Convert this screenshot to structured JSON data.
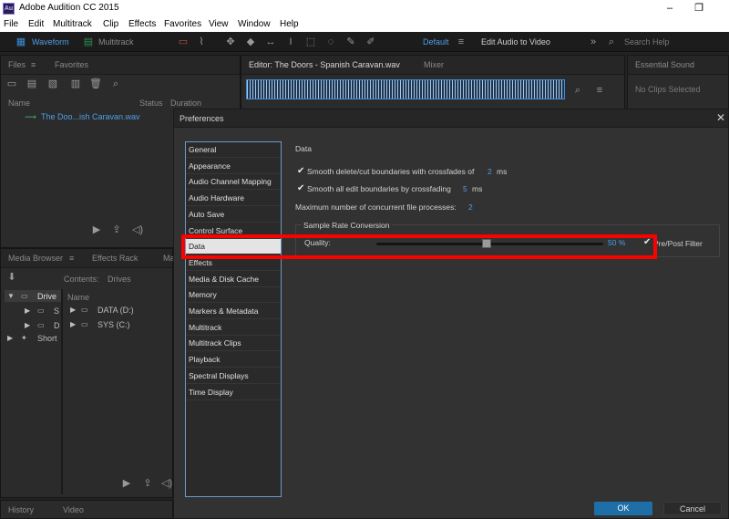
{
  "window": {
    "title": "Adobe Audition CC 2015",
    "icon_text": "Au"
  },
  "menu": [
    "File",
    "Edit",
    "Multitrack",
    "Clip",
    "Effects",
    "Favorites",
    "View",
    "Window",
    "Help"
  ],
  "toolbar": {
    "waveform": "Waveform",
    "multitrack": "Multitrack",
    "workspace": "Default",
    "workspace_alt": "Edit Audio to Video",
    "search_placeholder": "Search Help"
  },
  "files_panel": {
    "tabs": [
      "Files",
      "Favorites"
    ],
    "columns": [
      "Name",
      "Status",
      "Duration"
    ],
    "items": [
      "The Doo...ish Caravan.wav"
    ]
  },
  "editor_panel": {
    "tabs": [
      "Editor: The Doors - Spanish Caravan.wav",
      "Mixer"
    ]
  },
  "essential_sound": {
    "tab": "Essential Sound",
    "empty": "No Clips Selected"
  },
  "media_browser": {
    "tabs": [
      "Media Browser",
      "Effects Rack",
      "Ma"
    ],
    "contents_label": "Contents:",
    "contents_value": "Drives",
    "name_col": "Name",
    "tree": [
      "Drive",
      "S",
      "D",
      "Short"
    ],
    "drives": [
      "DATA (D:)",
      "SYS (C:)"
    ]
  },
  "bottom_tabs": [
    "History",
    "Video"
  ],
  "preferences": {
    "title": "Preferences",
    "categories": [
      "General",
      "Appearance",
      "Audio Channel Mapping",
      "Audio Hardware",
      "Auto Save",
      "Control Surface",
      "Data",
      "Effects",
      "Media & Disk Cache",
      "Memory",
      "Markers & Metadata",
      "Multitrack",
      "Multitrack Clips",
      "Playback",
      "Spectral Displays",
      "Time Display"
    ],
    "selected_index": 6,
    "section_title": "Data",
    "smooth_delete_label": "Smooth delete/cut boundaries with crossfades of",
    "smooth_delete_value": "2",
    "smooth_delete_unit": "ms",
    "smooth_edit_label": "Smooth all edit boundaries by crossfading",
    "smooth_edit_value": "5",
    "smooth_edit_unit": "ms",
    "max_files_label": "Maximum number of concurrent file processes:",
    "max_files_value": "2",
    "src_group": "Sample Rate Conversion",
    "quality_label": "Quality:",
    "quality_value": "50 %",
    "quality_fraction": 0.5,
    "prepost_label": "Pre/Post Filter",
    "ok": "OK",
    "cancel": "Cancel"
  },
  "colors": {
    "accent": "#1e6ea7",
    "highlight": "#ff0000",
    "link": "#4f9fe6",
    "waveform": "#3c8ed8"
  }
}
